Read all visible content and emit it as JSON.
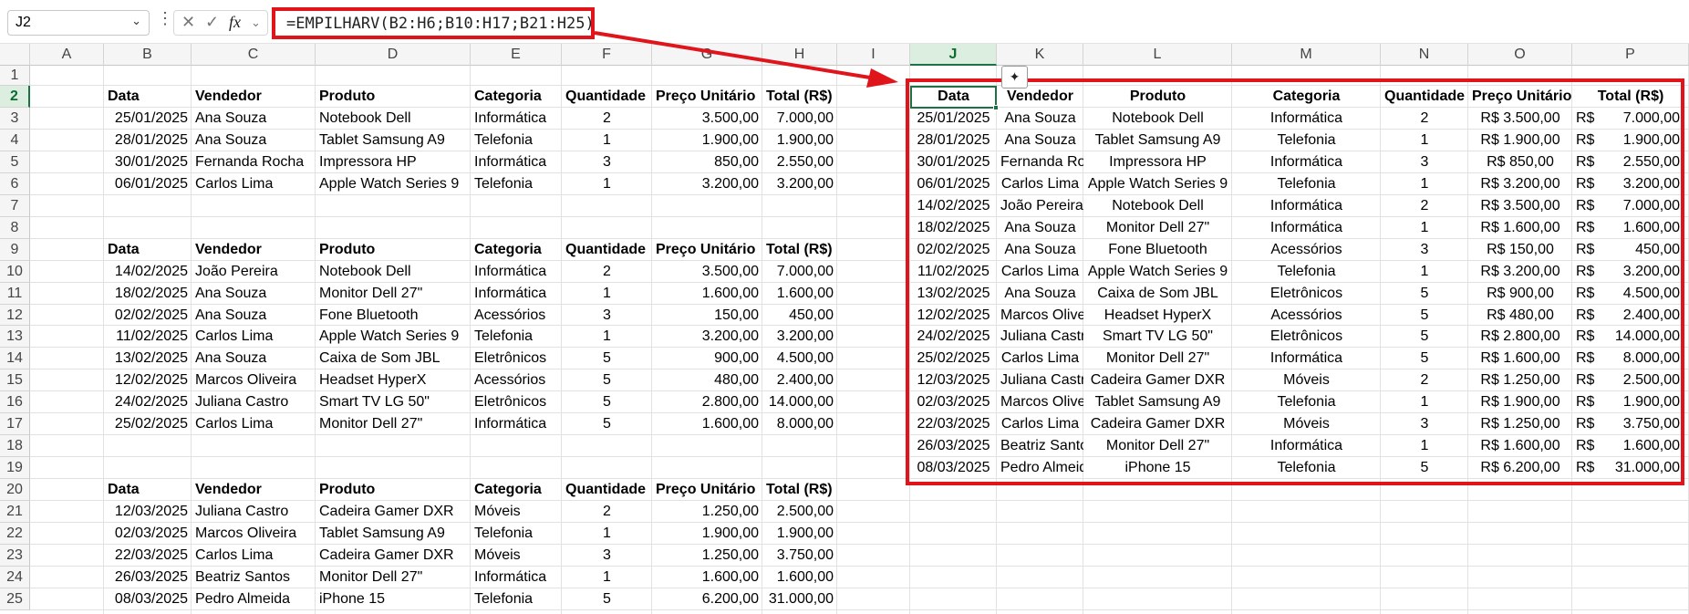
{
  "name_box": {
    "value": "J2"
  },
  "formula_bar": {
    "fx_label": "fx",
    "formula": "=EMPILHARV(B2:H6;B10:H17;B21:H25)"
  },
  "columns": [
    "A",
    "B",
    "C",
    "D",
    "E",
    "F",
    "G",
    "H",
    "I",
    "J",
    "K",
    "L",
    "M",
    "N",
    "O",
    "P"
  ],
  "rows": [
    "1",
    "2",
    "3",
    "4",
    "5",
    "6",
    "7",
    "8",
    "9",
    "10",
    "11",
    "12",
    "13",
    "14",
    "15",
    "16",
    "17",
    "18",
    "19",
    "20",
    "21",
    "22",
    "23",
    "24",
    "25"
  ],
  "headers": [
    "Data",
    "Vendedor",
    "Produto",
    "Categoria",
    "Quantidade",
    "Preço Unitário",
    "Total (R$)"
  ],
  "tables": [
    {
      "header_row": 2,
      "rows": [
        [
          "25/01/2025",
          "Ana Souza",
          "Notebook Dell",
          "Informática",
          "2",
          "3.500,00",
          "7.000,00"
        ],
        [
          "28/01/2025",
          "Ana Souza",
          "Tablet Samsung A9",
          "Telefonia",
          "1",
          "1.900,00",
          "1.900,00"
        ],
        [
          "30/01/2025",
          "Fernanda Rocha",
          "Impressora HP",
          "Informática",
          "3",
          "850,00",
          "2.550,00"
        ],
        [
          "06/01/2025",
          "Carlos Lima",
          "Apple Watch Series 9",
          "Telefonia",
          "1",
          "3.200,00",
          "3.200,00"
        ]
      ]
    },
    {
      "header_row": 9,
      "rows": [
        [
          "14/02/2025",
          "João Pereira",
          "Notebook Dell",
          "Informática",
          "2",
          "3.500,00",
          "7.000,00"
        ],
        [
          "18/02/2025",
          "Ana Souza",
          "Monitor Dell 27\"",
          "Informática",
          "1",
          "1.600,00",
          "1.600,00"
        ],
        [
          "02/02/2025",
          "Ana Souza",
          "Fone Bluetooth",
          "Acessórios",
          "3",
          "150,00",
          "450,00"
        ],
        [
          "11/02/2025",
          "Carlos Lima",
          "Apple Watch Series 9",
          "Telefonia",
          "1",
          "3.200,00",
          "3.200,00"
        ],
        [
          "13/02/2025",
          "Ana Souza",
          "Caixa de Som JBL",
          "Eletrônicos",
          "5",
          "900,00",
          "4.500,00"
        ],
        [
          "12/02/2025",
          "Marcos Oliveira",
          "Headset HyperX",
          "Acessórios",
          "5",
          "480,00",
          "2.400,00"
        ],
        [
          "24/02/2025",
          "Juliana Castro",
          "Smart TV LG 50\"",
          "Eletrônicos",
          "5",
          "2.800,00",
          "14.000,00"
        ],
        [
          "25/02/2025",
          "Carlos Lima",
          "Monitor Dell 27\"",
          "Informática",
          "5",
          "1.600,00",
          "8.000,00"
        ]
      ]
    },
    {
      "header_row": 20,
      "rows": [
        [
          "12/03/2025",
          "Juliana Castro",
          "Cadeira Gamer DXR",
          "Móveis",
          "2",
          "1.250,00",
          "2.500,00"
        ],
        [
          "02/03/2025",
          "Marcos Oliveira",
          "Tablet Samsung A9",
          "Telefonia",
          "1",
          "1.900,00",
          "1.900,00"
        ],
        [
          "22/03/2025",
          "Carlos Lima",
          "Cadeira Gamer DXR",
          "Móveis",
          "3",
          "1.250,00",
          "3.750,00"
        ],
        [
          "26/03/2025",
          "Beatriz Santos",
          "Monitor Dell 27\"",
          "Informática",
          "1",
          "1.600,00",
          "1.600,00"
        ],
        [
          "08/03/2025",
          "Pedro Almeida",
          "iPhone 15",
          "Telefonia",
          "5",
          "6.200,00",
          "31.000,00"
        ]
      ]
    }
  ],
  "result": {
    "rows": [
      [
        "25/01/2025",
        "Ana Souza",
        "Notebook Dell",
        "Informática",
        "2",
        "R$ 3.500,00",
        "R$",
        "7.000,00"
      ],
      [
        "28/01/2025",
        "Ana Souza",
        "Tablet Samsung A9",
        "Telefonia",
        "1",
        "R$ 1.900,00",
        "R$",
        "1.900,00"
      ],
      [
        "30/01/2025",
        "Fernanda Rocha",
        "Impressora HP",
        "Informática",
        "3",
        "R$ 850,00",
        "R$",
        "2.550,00"
      ],
      [
        "06/01/2025",
        "Carlos Lima",
        "Apple Watch Series 9",
        "Telefonia",
        "1",
        "R$ 3.200,00",
        "R$",
        "3.200,00"
      ],
      [
        "14/02/2025",
        "João Pereira",
        "Notebook Dell",
        "Informática",
        "2",
        "R$ 3.500,00",
        "R$",
        "7.000,00"
      ],
      [
        "18/02/2025",
        "Ana Souza",
        "Monitor Dell 27\"",
        "Informática",
        "1",
        "R$ 1.600,00",
        "R$",
        "1.600,00"
      ],
      [
        "02/02/2025",
        "Ana Souza",
        "Fone Bluetooth",
        "Acessórios",
        "3",
        "R$ 150,00",
        "R$",
        "450,00"
      ],
      [
        "11/02/2025",
        "Carlos Lima",
        "Apple Watch Series 9",
        "Telefonia",
        "1",
        "R$ 3.200,00",
        "R$",
        "3.200,00"
      ],
      [
        "13/02/2025",
        "Ana Souza",
        "Caixa de Som JBL",
        "Eletrônicos",
        "5",
        "R$ 900,00",
        "R$",
        "4.500,00"
      ],
      [
        "12/02/2025",
        "Marcos Oliveira",
        "Headset HyperX",
        "Acessórios",
        "5",
        "R$ 480,00",
        "R$",
        "2.400,00"
      ],
      [
        "24/02/2025",
        "Juliana Castro",
        "Smart TV LG 50\"",
        "Eletrônicos",
        "5",
        "R$ 2.800,00",
        "R$",
        "14.000,00"
      ],
      [
        "25/02/2025",
        "Carlos Lima",
        "Monitor Dell 27\"",
        "Informática",
        "5",
        "R$ 1.600,00",
        "R$",
        "8.000,00"
      ],
      [
        "12/03/2025",
        "Juliana Castro",
        "Cadeira Gamer DXR",
        "Móveis",
        "2",
        "R$ 1.250,00",
        "R$",
        "2.500,00"
      ],
      [
        "02/03/2025",
        "Marcos Oliveira",
        "Tablet Samsung A9",
        "Telefonia",
        "1",
        "R$ 1.900,00",
        "R$",
        "1.900,00"
      ],
      [
        "22/03/2025",
        "Carlos Lima",
        "Cadeira Gamer DXR",
        "Móveis",
        "3",
        "R$ 1.250,00",
        "R$",
        "3.750,00"
      ],
      [
        "26/03/2025",
        "Beatriz Santos",
        "Monitor Dell 27\"",
        "Informática",
        "1",
        "R$ 1.600,00",
        "R$",
        "1.600,00"
      ],
      [
        "08/03/2025",
        "Pedro Almeida",
        "iPhone 15",
        "Telefonia",
        "5",
        "R$ 6.200,00",
        "R$",
        "31.000,00"
      ]
    ]
  },
  "colors": {
    "highlight_red": "#e0141b",
    "selection_green": "#1e7145"
  },
  "icons": {
    "cancel": "close-icon",
    "enter": "check-icon",
    "spill": "quick-analysis-icon",
    "namebox": "chevron-down-icon"
  }
}
